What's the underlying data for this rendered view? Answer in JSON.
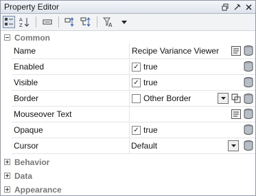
{
  "window": {
    "title": "Property Editor"
  },
  "toolbar": {
    "items": [
      "categorized-icon",
      "alphabetical-icon",
      "property-icon",
      "add-dynamic-icon",
      "tree-icon",
      "filter-icon",
      "filter-dropdown-icon"
    ]
  },
  "categories": {
    "common": "Common",
    "behavior": "Behavior",
    "data": "Data",
    "appearance": "Appearance"
  },
  "properties": [
    {
      "name": "Name",
      "value": "Recipe Variance Viewer"
    },
    {
      "name": "Enabled",
      "value": "true",
      "checked": true
    },
    {
      "name": "Visible",
      "value": "true",
      "checked": true
    },
    {
      "name": "Border",
      "value": "Other Border",
      "checked": false
    },
    {
      "name": "Mouseover Text",
      "value": ""
    },
    {
      "name": "Opaque",
      "value": "true",
      "checked": true
    },
    {
      "name": "Cursor",
      "value": "Default"
    }
  ],
  "colors": {
    "accent": "#7a8aa6",
    "category_text": "#777777"
  }
}
